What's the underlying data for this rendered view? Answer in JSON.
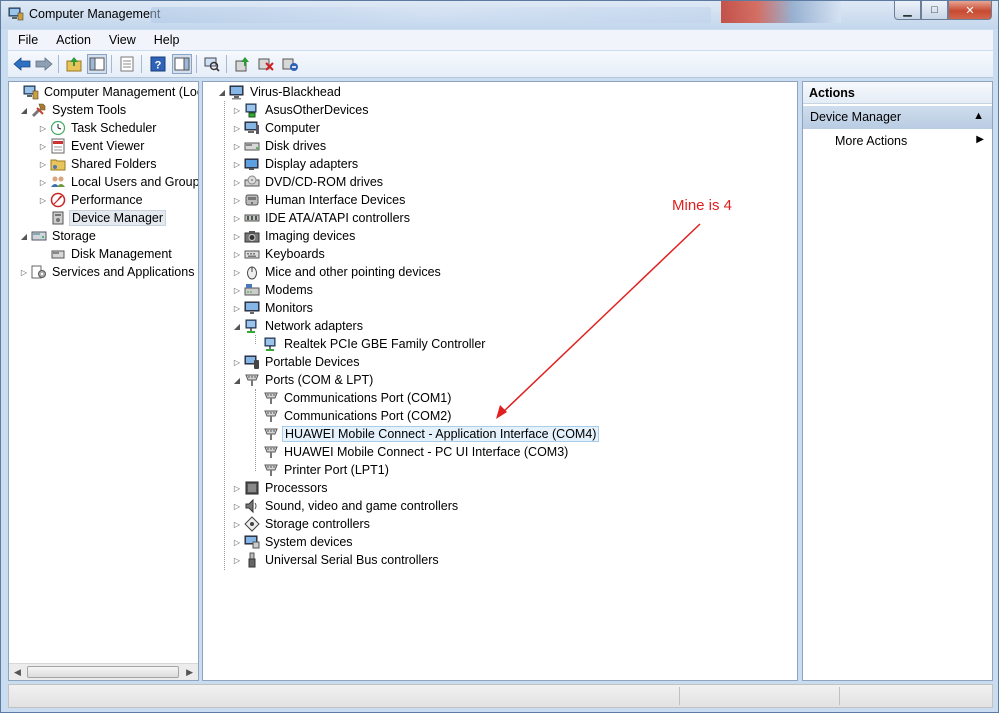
{
  "window": {
    "title": "Computer Management",
    "controls": {
      "minimize": "▁",
      "maximize": "□",
      "close": "✕"
    }
  },
  "menu": [
    "File",
    "Action",
    "View",
    "Help"
  ],
  "toolbar": {
    "icons": [
      "back-arrow-icon",
      "forward-arrow-icon",
      "up-folder-icon",
      "show-hide-console-tree-icon",
      "properties-icon",
      "help-icon",
      "show-hide-action-pane-icon",
      "scan-hardware-icon",
      "update-driver-icon",
      "disable-device-icon",
      "uninstall-device-icon"
    ]
  },
  "left_tree": {
    "root": "Computer Management (Local",
    "items": [
      {
        "label": "System Tools",
        "level": 1,
        "expander": "◢",
        "icon": "tools-icon"
      },
      {
        "label": "Task Scheduler",
        "level": 2,
        "expander": "▷",
        "icon": "clock-icon"
      },
      {
        "label": "Event Viewer",
        "level": 2,
        "expander": "▷",
        "icon": "event-viewer-icon"
      },
      {
        "label": "Shared Folders",
        "level": 2,
        "expander": "▷",
        "icon": "shared-folder-icon"
      },
      {
        "label": "Local Users and Groups",
        "level": 2,
        "expander": "▷",
        "icon": "users-icon"
      },
      {
        "label": "Performance",
        "level": 2,
        "expander": "▷",
        "icon": "performance-icon"
      },
      {
        "label": "Device Manager",
        "level": 2,
        "expander": "",
        "icon": "device-manager-icon",
        "selected": true
      },
      {
        "label": "Storage",
        "level": 1,
        "expander": "◢",
        "icon": "storage-icon"
      },
      {
        "label": "Disk Management",
        "level": 2,
        "expander": "",
        "icon": "disk-icon"
      },
      {
        "label": "Services and Applications",
        "level": 1,
        "expander": "▷",
        "icon": "services-icon"
      }
    ]
  },
  "device_tree": {
    "root": "Virus-Blackhead",
    "items": [
      {
        "label": "AsusOtherDevices",
        "level": 1,
        "expander": "▷",
        "icon": "network-device-icon"
      },
      {
        "label": "Computer",
        "level": 1,
        "expander": "▷",
        "icon": "computer-icon"
      },
      {
        "label": "Disk drives",
        "level": 1,
        "expander": "▷",
        "icon": "disk-drive-icon"
      },
      {
        "label": "Display adapters",
        "level": 1,
        "expander": "▷",
        "icon": "display-adapter-icon"
      },
      {
        "label": "DVD/CD-ROM drives",
        "level": 1,
        "expander": "▷",
        "icon": "dvd-drive-icon"
      },
      {
        "label": "Human Interface Devices",
        "level": 1,
        "expander": "▷",
        "icon": "hid-icon"
      },
      {
        "label": "IDE ATA/ATAPI controllers",
        "level": 1,
        "expander": "▷",
        "icon": "ide-controller-icon"
      },
      {
        "label": "Imaging devices",
        "level": 1,
        "expander": "▷",
        "icon": "camera-icon"
      },
      {
        "label": "Keyboards",
        "level": 1,
        "expander": "▷",
        "icon": "keyboard-icon"
      },
      {
        "label": "Mice and other pointing devices",
        "level": 1,
        "expander": "▷",
        "icon": "mouse-icon"
      },
      {
        "label": "Modems",
        "level": 1,
        "expander": "▷",
        "icon": "modem-icon"
      },
      {
        "label": "Monitors",
        "level": 1,
        "expander": "▷",
        "icon": "monitor-icon"
      },
      {
        "label": "Network adapters",
        "level": 1,
        "expander": "◢",
        "icon": "network-adapter-icon"
      },
      {
        "label": "Realtek PCIe GBE Family Controller",
        "level": 2,
        "expander": "",
        "icon": "network-adapter-icon"
      },
      {
        "label": "Portable Devices",
        "level": 1,
        "expander": "▷",
        "icon": "portable-device-icon"
      },
      {
        "label": "Ports (COM & LPT)",
        "level": 1,
        "expander": "◢",
        "icon": "port-icon"
      },
      {
        "label": "Communications Port (COM1)",
        "level": 2,
        "expander": "",
        "icon": "port-icon"
      },
      {
        "label": "Communications Port (COM2)",
        "level": 2,
        "expander": "",
        "icon": "port-icon"
      },
      {
        "label": "HUAWEI Mobile Connect - Application Interface (COM4)",
        "level": 2,
        "expander": "",
        "icon": "port-icon",
        "highlight": true
      },
      {
        "label": "HUAWEI Mobile Connect - PC UI Interface (COM3)",
        "level": 2,
        "expander": "",
        "icon": "port-icon"
      },
      {
        "label": "Printer Port (LPT1)",
        "level": 2,
        "expander": "",
        "icon": "port-icon"
      },
      {
        "label": "Processors",
        "level": 1,
        "expander": "▷",
        "icon": "processor-icon"
      },
      {
        "label": "Sound, video and game controllers",
        "level": 1,
        "expander": "▷",
        "icon": "speaker-icon"
      },
      {
        "label": "Storage controllers",
        "level": 1,
        "expander": "▷",
        "icon": "storage-controller-icon"
      },
      {
        "label": "System devices",
        "level": 1,
        "expander": "▷",
        "icon": "system-device-icon"
      },
      {
        "label": "Universal Serial Bus controllers",
        "level": 1,
        "expander": "▷",
        "icon": "usb-icon"
      }
    ]
  },
  "actions": {
    "header": "Actions",
    "section": "Device Manager",
    "section_toggle": "▲",
    "more": "More Actions",
    "more_arrow": "▶"
  },
  "annotation": {
    "text": "Mine is 4",
    "color": "#e02020"
  }
}
